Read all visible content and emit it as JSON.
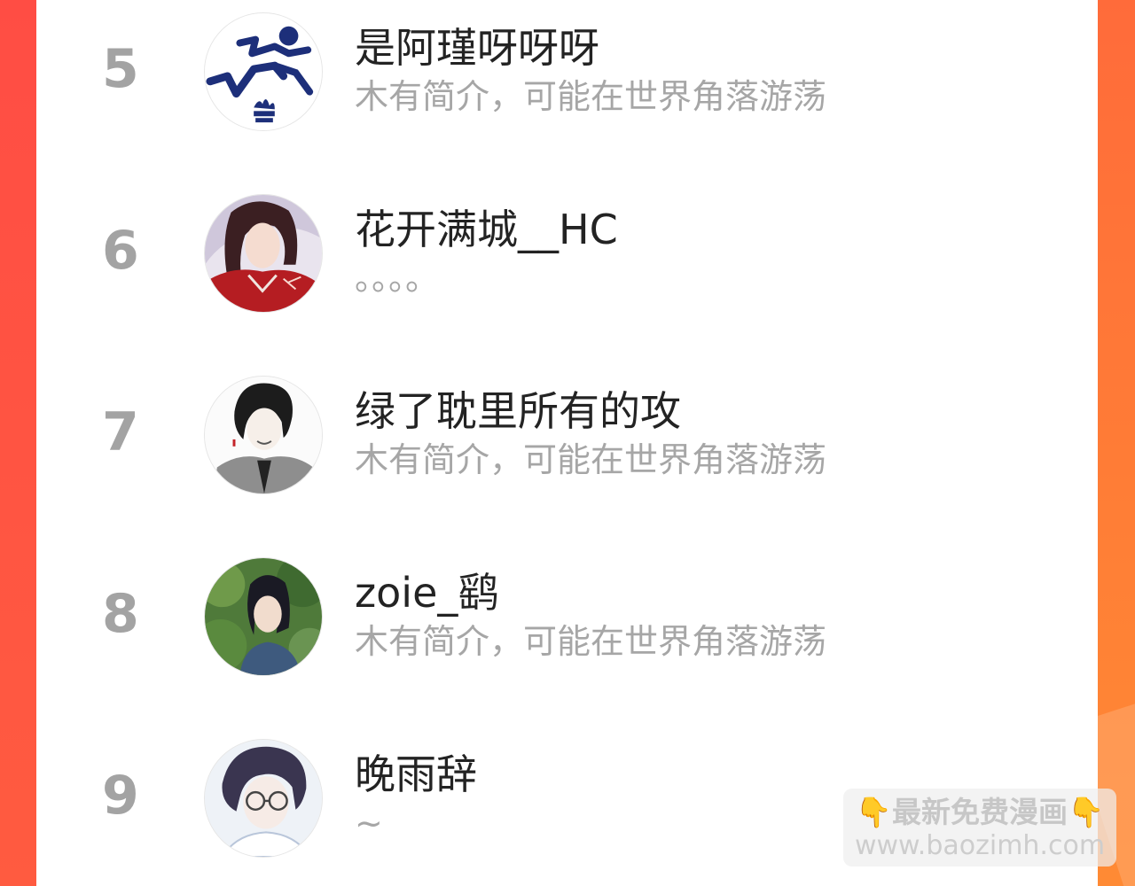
{
  "users": [
    {
      "rank": "5",
      "name": "是阿瑾呀呀呀",
      "bio": "木有简介，可能在世界角落游荡",
      "avatar_icon": "running-athlete-logo-icon"
    },
    {
      "rank": "6",
      "name": "花开满城__HC",
      "bio": "。。。。",
      "avatar_icon": "anime-red-robe-portrait-icon"
    },
    {
      "rank": "7",
      "name": "绿了耽里所有的攻",
      "bio": "木有简介，可能在世界角落游荡",
      "avatar_icon": "anime-dark-hair-sketch-icon"
    },
    {
      "rank": "8",
      "name": "zoie_鹞",
      "bio": "木有简介，可能在世界角落游荡",
      "avatar_icon": "cosplay-portrait-photo-icon"
    },
    {
      "rank": "9",
      "name": "晚雨辞",
      "bio": "~",
      "avatar_icon": "anime-glasses-portrait-icon"
    }
  ],
  "watermark": {
    "hand_icon": "👇",
    "line1": "最新免费漫画",
    "line2": "www.baozimh.com"
  },
  "colors": {
    "background_accent": "#ff5a44",
    "rank": "#a3a3a3",
    "name": "#232323",
    "bio": "#a6a6a6"
  }
}
